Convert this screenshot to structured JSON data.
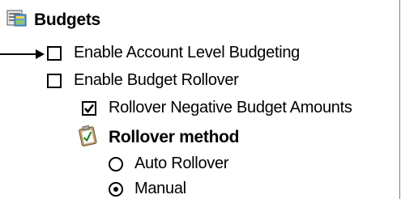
{
  "section": {
    "title": "Budgets",
    "icon": "budget-folder-icon"
  },
  "options": [
    {
      "label": "Enable Account Level Budgeting",
      "checked": false
    },
    {
      "label": "Enable Budget Rollover",
      "checked": false
    },
    {
      "label": "Rollover Negative Budget Amounts",
      "checked": true
    }
  ],
  "rollover_method": {
    "title": "Rollover method",
    "icon": "clipboard-check-icon",
    "choices": [
      {
        "label": "Auto Rollover",
        "selected": false
      },
      {
        "label": "Manual",
        "selected": true
      }
    ]
  },
  "annotation": {
    "icon": "pointer-arrow-icon"
  }
}
